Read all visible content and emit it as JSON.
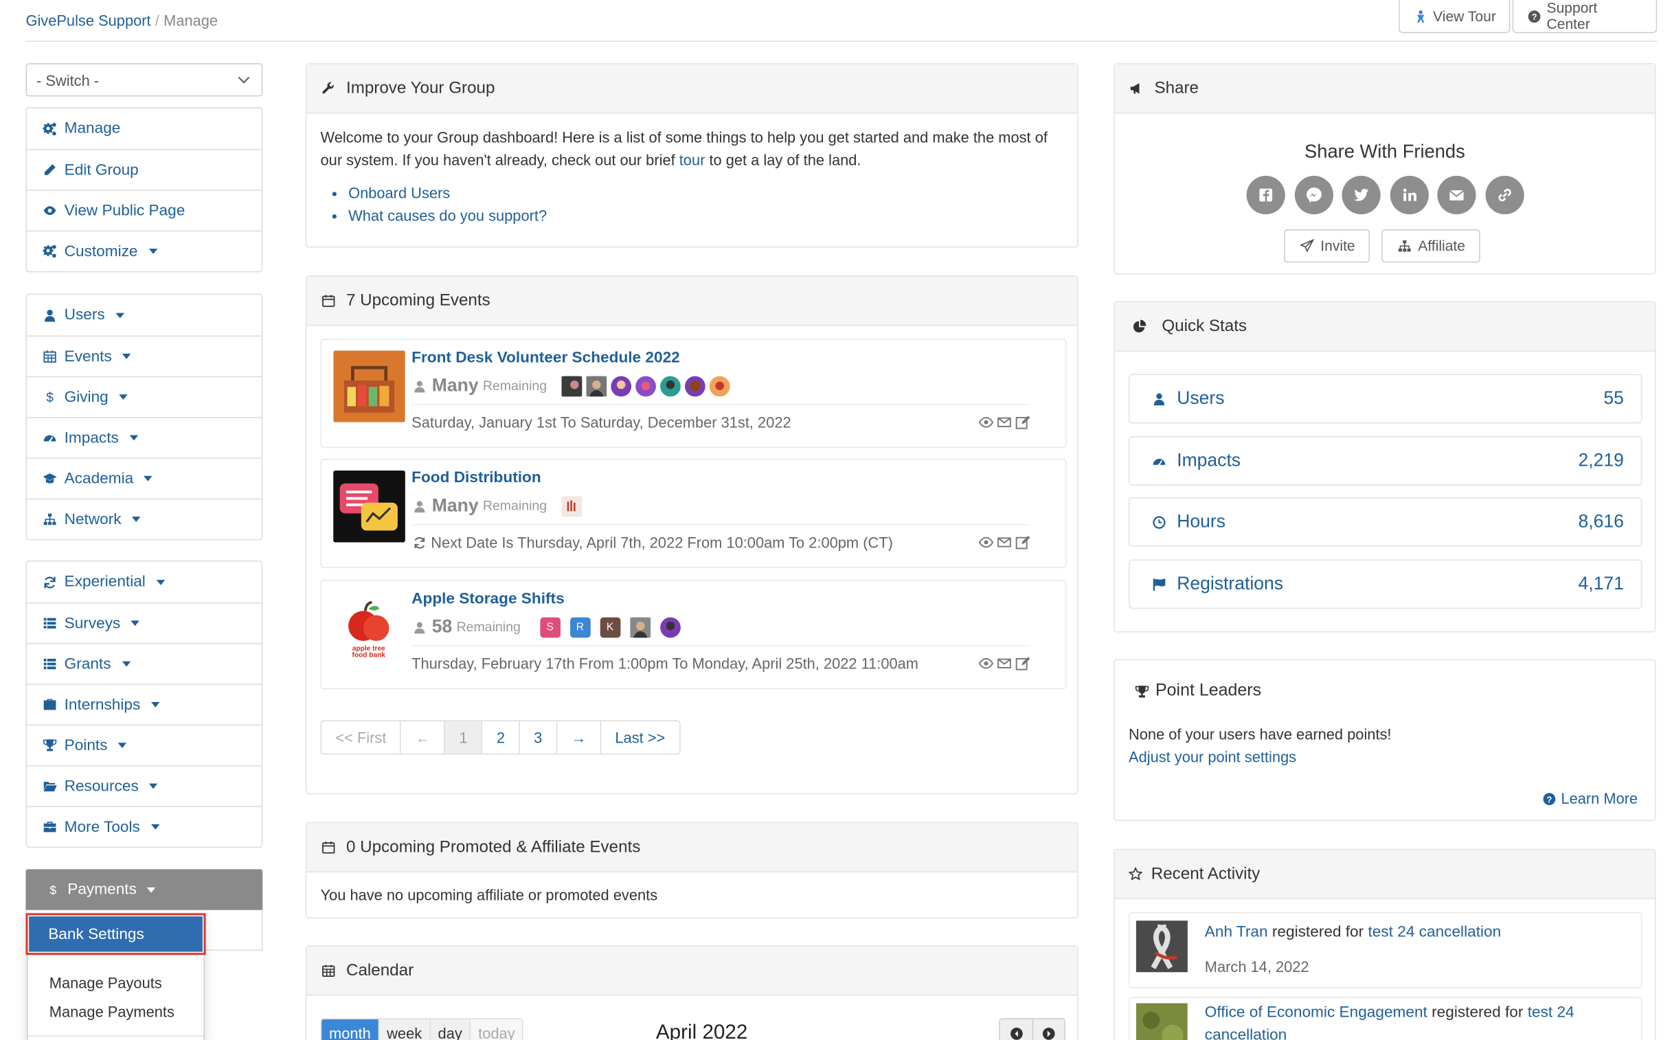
{
  "header": {
    "breadcrumb_root": "GivePulse Support",
    "breadcrumb_sep": "/",
    "breadcrumb_current": "Manage",
    "view_tour": "View Tour",
    "support_center": "Support Center"
  },
  "sidebar": {
    "switch_label": "- Switch -",
    "group1": [
      {
        "label": "Manage",
        "icon": "cogs-icon",
        "caret": false
      },
      {
        "label": "Edit Group",
        "icon": "pencil-icon",
        "caret": false
      },
      {
        "label": "View Public Page",
        "icon": "eye-icon",
        "caret": false
      },
      {
        "label": "Customize",
        "icon": "cogs-icon",
        "caret": true
      }
    ],
    "group2": [
      {
        "label": "Users",
        "icon": "user-icon",
        "caret": true
      },
      {
        "label": "Events",
        "icon": "calendar-icon",
        "caret": true
      },
      {
        "label": "Giving",
        "icon": "dollar-icon",
        "caret": true
      },
      {
        "label": "Impacts",
        "icon": "dashboard-icon",
        "caret": true
      },
      {
        "label": "Academia",
        "icon": "graduation-cap-icon",
        "caret": true
      },
      {
        "label": "Network",
        "icon": "sitemap-icon",
        "caret": true
      }
    ],
    "group3": [
      {
        "label": "Experiential",
        "icon": "refresh-icon",
        "caret": true
      },
      {
        "label": "Surveys",
        "icon": "list-icon",
        "caret": true
      },
      {
        "label": "Grants",
        "icon": "list-icon",
        "caret": true
      },
      {
        "label": "Internships",
        "icon": "briefcase-icon",
        "caret": true
      },
      {
        "label": "Points",
        "icon": "trophy-icon",
        "caret": true
      },
      {
        "label": "Resources",
        "icon": "folder-icon",
        "caret": true
      },
      {
        "label": "More Tools",
        "icon": "toolbox-icon",
        "caret": true
      }
    ],
    "payments_label": "Payments",
    "payments_menu": {
      "active": "Bank Settings",
      "items": [
        "Manage Payouts",
        "Manage Payments"
      ]
    }
  },
  "improve": {
    "title": "Improve Your Group",
    "text_before": "Welcome to your Group dashboard! Here is a list of some things to help you get started and make the most of our system. If you haven't already, check out our brief ",
    "tour_link": "tour",
    "text_after": " to get a lay of the land.",
    "links": [
      "Onboard Users",
      "What causes do you support?"
    ]
  },
  "events": {
    "title": "7 Upcoming Events",
    "items": [
      {
        "title": "Front Desk Volunteer Schedule 2022",
        "count": "Many",
        "remaining": "Remaining",
        "date": "Saturday, January 1st To Saturday, December 31st, 2022",
        "recurring": false
      },
      {
        "title": "Food Distribution",
        "count": "Many",
        "remaining": "Remaining",
        "date": "Next Date Is Thursday, April 7th, 2022 From 10:00am To 2:00pm (CT)",
        "recurring": true
      },
      {
        "title": "Apple Storage Shifts",
        "count": "58",
        "remaining": "Remaining",
        "date": "Thursday, February 17th From 1:00pm To Monday, April 25th, 2022 11:00am",
        "recurring": false
      }
    ],
    "avatar_letters": [
      "S",
      "R",
      "K"
    ],
    "pager": {
      "first": "<< First",
      "prev": "←",
      "pages": [
        "1",
        "2",
        "3"
      ],
      "active_page": "1",
      "next": "→",
      "last": "Last >>"
    }
  },
  "promoted": {
    "title": "0 Upcoming Promoted & Affiliate Events",
    "text": "You have no upcoming affiliate or promoted events"
  },
  "calendar": {
    "title": "Calendar",
    "views": [
      "month",
      "week",
      "day",
      "today"
    ],
    "active_view": "month",
    "current": "April 2022"
  },
  "share": {
    "title": "Share",
    "subtitle": "Share With Friends",
    "networks": [
      "facebook-icon",
      "messenger-icon",
      "twitter-icon",
      "linkedin-icon",
      "envelope-icon",
      "link-icon"
    ],
    "invite": "Invite",
    "affiliate": "Affiliate"
  },
  "stats": {
    "title": "Quick Stats",
    "items": [
      {
        "label": "Users",
        "value": "55",
        "icon": "user-icon"
      },
      {
        "label": "Impacts",
        "value": "2,219",
        "icon": "dashboard-icon"
      },
      {
        "label": "Hours",
        "value": "8,616",
        "icon": "clock-icon"
      },
      {
        "label": "Registrations",
        "value": "4,171",
        "icon": "flag-icon"
      }
    ]
  },
  "points": {
    "title": "Point Leaders",
    "text": "None of your users have earned points!",
    "link": "Adjust your point settings",
    "learn_more": "Learn More"
  },
  "activity": {
    "title": "Recent Activity",
    "items": [
      {
        "user": "Anh Tran",
        "verb": "registered for",
        "event": "test 24 cancellation",
        "date": "March 14, 2022"
      },
      {
        "user": "Office of Economic Engagement",
        "verb": "registered for",
        "event": "test 24 cancellation",
        "date": ""
      }
    ]
  },
  "colors": {
    "link": "#1f5f99",
    "active_menu": "#2f6db0",
    "highlight": "#e03a2f",
    "calendar_active": "#3a87d6"
  }
}
